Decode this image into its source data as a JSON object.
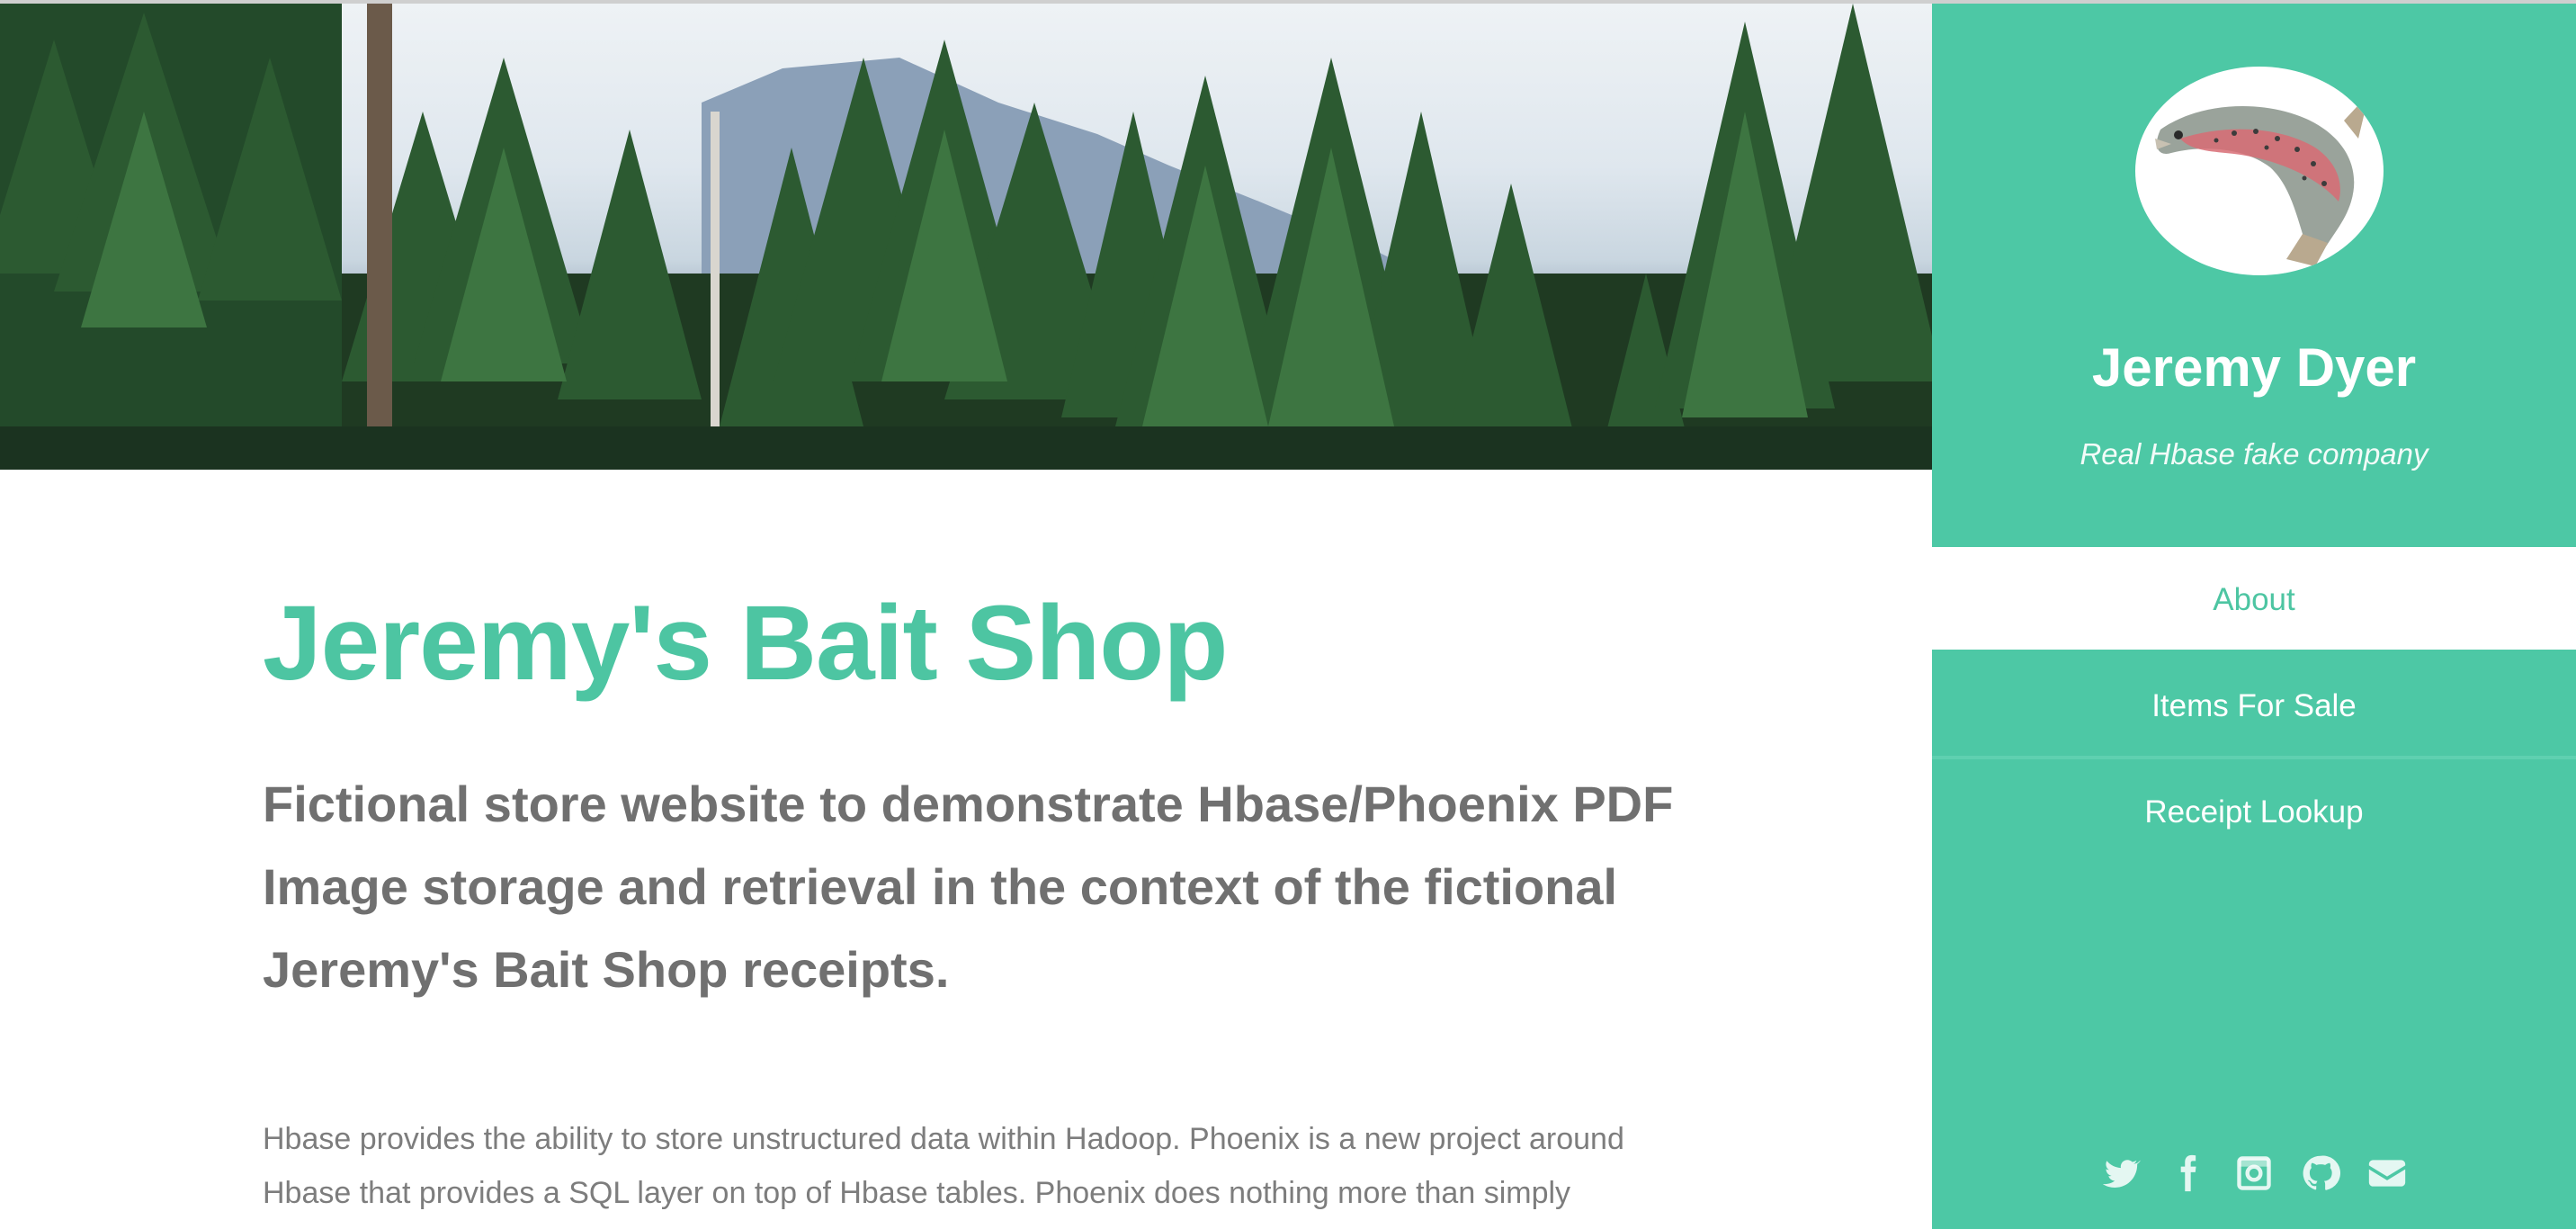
{
  "main": {
    "title": "Jeremy's Bait Shop",
    "subtitle": "Fictional store website to demonstrate Hbase/Phoenix PDF Image storage and retrieval in the context of the fictional Jeremy's Bait Shop receipts.",
    "body": "Hbase provides the ability to store unstructured data within Hadoop. Phoenix is a new project around Hbase that provides a SQL layer on top of Hbase tables. Phoenix does nothing more than simply"
  },
  "sidebar": {
    "name": "Jeremy Dyer",
    "tagline": "Real Hbase fake company",
    "nav": [
      {
        "label": "About",
        "active": true
      },
      {
        "label": "Items For Sale",
        "active": false
      },
      {
        "label": "Receipt Lookup",
        "active": false
      }
    ],
    "social_icons": [
      "twitter-icon",
      "facebook-icon",
      "instagram-icon",
      "github-icon",
      "email-icon"
    ]
  },
  "colors": {
    "accent": "#4dc5a2",
    "sidebar_bg": "#4dc8a5",
    "heading_gray": "#707070",
    "body_gray": "#7d7d7d"
  }
}
